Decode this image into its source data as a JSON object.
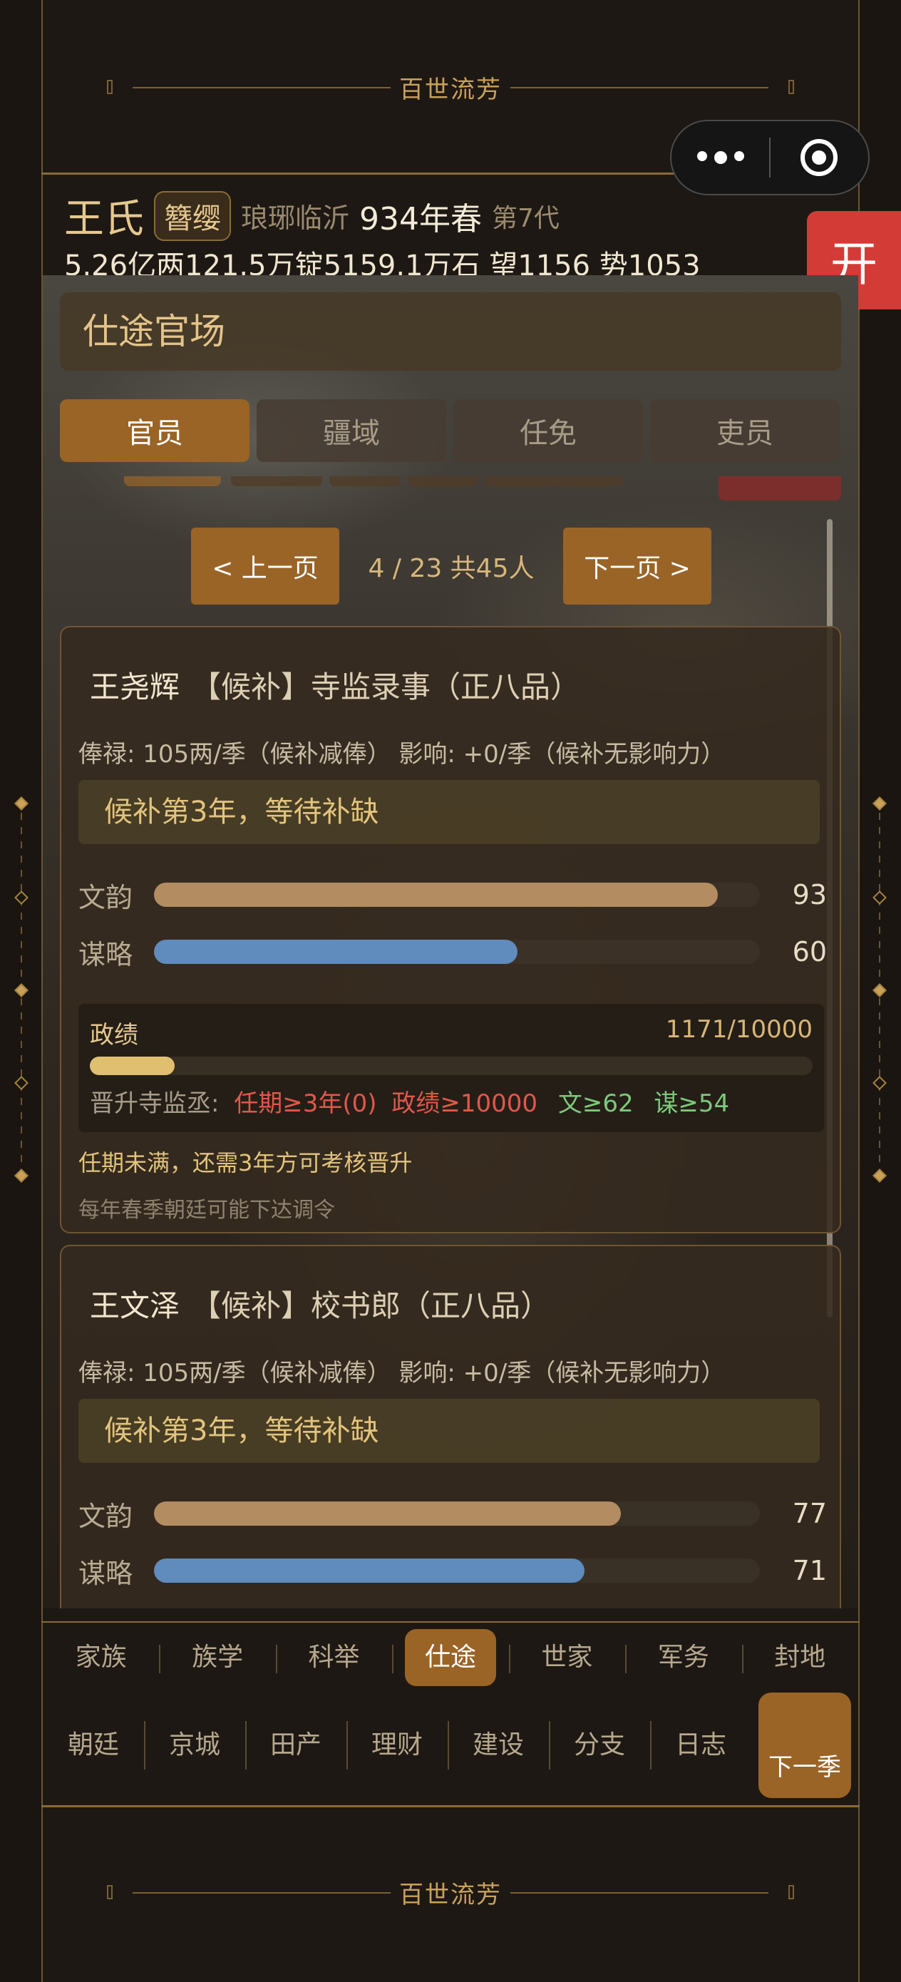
{
  "app_title": "百世流芳",
  "colors": {
    "accent": "#9a6426",
    "gold": "#c9a15a",
    "open_red": "#d23b36"
  },
  "capsule": {
    "more_icon": "more-dots-icon",
    "close_icon": "target-icon"
  },
  "open_button": "开",
  "header": {
    "clan_name": "王氏",
    "rank": "簪缨",
    "place": "琅琊临沂",
    "year": "934年春",
    "generation": "第7代",
    "resources": "5.26亿两121.5万锭5159.1万石  望1156  势1053"
  },
  "section": {
    "title": "仕途官场"
  },
  "tabs": [
    {
      "label": "官员",
      "active": true
    },
    {
      "label": "疆域",
      "active": false
    },
    {
      "label": "任免",
      "active": false
    },
    {
      "label": "吏员",
      "active": false
    }
  ],
  "pager": {
    "prev": "< 上一页",
    "info": "4 / 23  共45人",
    "next": "下一页 >"
  },
  "officials": [
    {
      "name": "王尧辉",
      "position": "【候补】寺监录事（正八品）",
      "info": "俸禄: 105两/季（候补减俸）  影响: +0/季（候补无影响力）",
      "notice": "候补第3年，等待补缺",
      "wenyun_label": "文韵",
      "wenyun": 93,
      "moulue_label": "谋略",
      "moulue": 60,
      "perf_label": "政绩",
      "perf_value": 1171,
      "perf_max": 10000,
      "perf_text": "1171/10000",
      "req_prefix": "晋升寺监丞:",
      "req_term": "任期≥3年(0)",
      "req_perf": "政绩≥10000",
      "req_wen": "文≥62",
      "req_mou": "谋≥54",
      "warn": "任期未满，还需3年方可考核晋升",
      "tip": "每年春季朝廷可能下达调令"
    },
    {
      "name": "王文泽",
      "position": "【候补】校书郎（正八品）",
      "info": "俸禄: 105两/季（候补减俸）  影响: +0/季（候补无影响力）",
      "notice": "候补第3年，等待补缺",
      "wenyun_label": "文韵",
      "wenyun": 77,
      "moulue_label": "谋略",
      "moulue": 71
    }
  ],
  "nav_main": [
    {
      "label": "家族",
      "active": false
    },
    {
      "label": "族学",
      "active": false
    },
    {
      "label": "科举",
      "active": false
    },
    {
      "label": "仕途",
      "active": true
    },
    {
      "label": "世家",
      "active": false
    },
    {
      "label": "军务",
      "active": false
    },
    {
      "label": "封地",
      "active": false
    }
  ],
  "nav_sub": [
    "朝廷",
    "京城",
    "田产",
    "理财",
    "建设",
    "分支",
    "日志"
  ],
  "next_season": "下一季"
}
